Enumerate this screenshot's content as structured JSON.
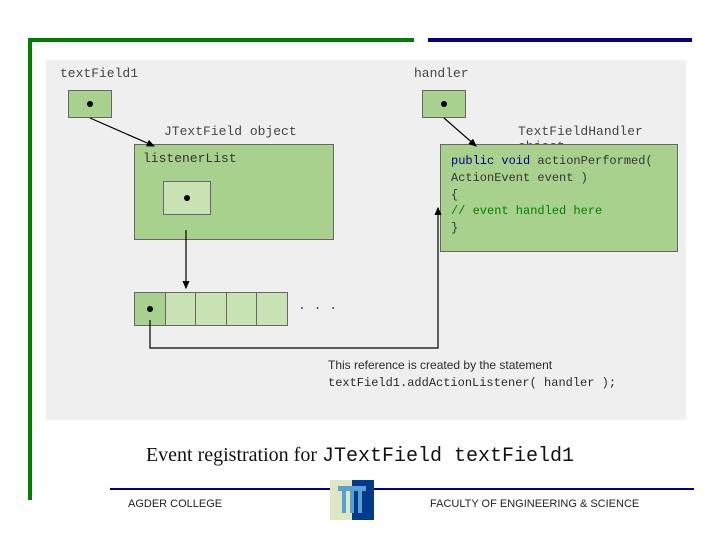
{
  "diagram": {
    "ref_tf1": "textField1",
    "ref_handler": "handler",
    "obj_label_left": "JTextField object",
    "obj_label_right": "TextFieldHandler object",
    "listener_title": "listenerList",
    "method": {
      "sig1": "public void",
      "sig2": " actionPerformed(",
      "sig3": "  ActionEvent event )",
      "brace_open": "{",
      "comment": "  // event handled here",
      "brace_close": "}"
    },
    "ellipsis": ". . .",
    "note_line1": "This reference is created by the statement",
    "note_line2": "textField1.addActionListener( handler );"
  },
  "caption": {
    "prefix": "Event registration for ",
    "code": "JTextField textField1"
  },
  "footer": {
    "left": "AGDER COLLEGE",
    "right": "FACULTY OF ENGINEERING & SCIENCE"
  },
  "colors": {
    "green": "#008000",
    "navy": "#000080",
    "box_green": "#a8d18d"
  }
}
